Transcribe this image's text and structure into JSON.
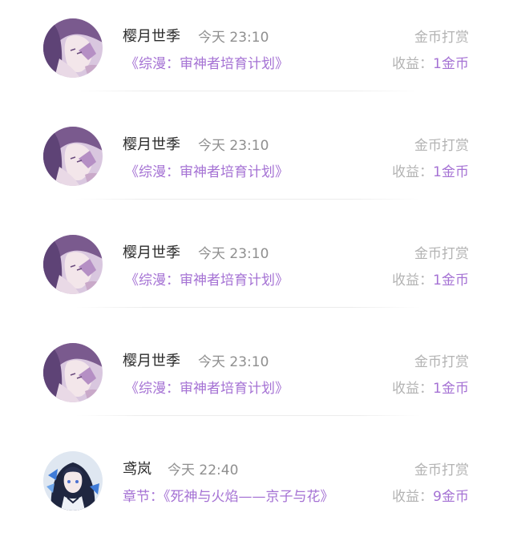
{
  "records": [
    {
      "user": "樱月世季",
      "time": "今天 23:10",
      "work": "《综漫：审神者培育计划》",
      "type": "金币打赏",
      "income_label": "收益：",
      "income_value": "1金币",
      "avatar_icon": "anime-avatar-purple"
    },
    {
      "user": "樱月世季",
      "time": "今天 23:10",
      "work": "《综漫：审神者培育计划》",
      "type": "金币打赏",
      "income_label": "收益：",
      "income_value": "1金币",
      "avatar_icon": "anime-avatar-purple"
    },
    {
      "user": "樱月世季",
      "time": "今天 23:10",
      "work": "《综漫：审神者培育计划》",
      "type": "金币打赏",
      "income_label": "收益：",
      "income_value": "1金币",
      "avatar_icon": "anime-avatar-purple"
    },
    {
      "user": "樱月世季",
      "time": "今天 23:10",
      "work": "《综漫：审神者培育计划》",
      "type": "金币打赏",
      "income_label": "收益：",
      "income_value": "1金币",
      "avatar_icon": "anime-avatar-purple"
    },
    {
      "user": "鸢岚",
      "time": "今天 22:40",
      "work": "章节：《死神与火焰——京子与花》",
      "type": "金币打赏",
      "income_label": "收益：",
      "income_value": "9金币",
      "avatar_icon": "anime-avatar-blue"
    }
  ],
  "colors": {
    "accent": "#a572d4",
    "muted": "#b3b3b3",
    "name": "#2b2b2b"
  }
}
